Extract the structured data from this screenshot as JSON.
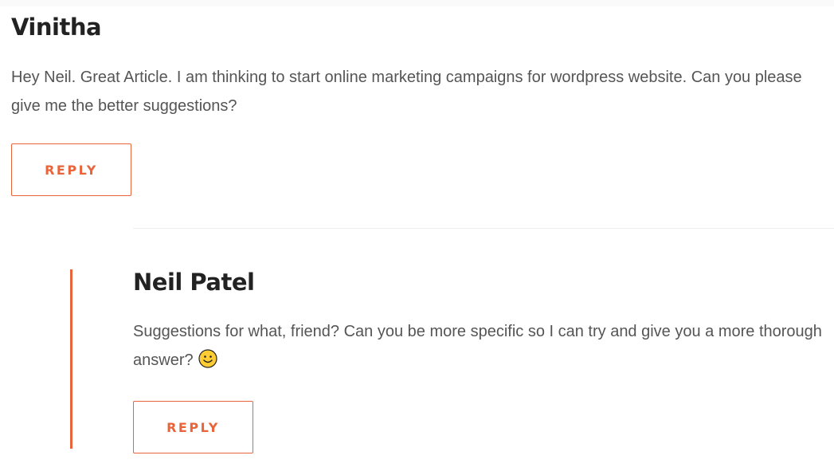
{
  "comments": [
    {
      "author": "Vinitha",
      "text": "Hey Neil. Great Article. I am thinking to start online marketing campaigns for wordpress website. Can you please give me the better suggestions?",
      "reply_label": "REPLY"
    },
    {
      "author": "Neil Patel",
      "text": "Suggestions for what, friend? Can you be more specific so I can try and give you a more thorough answer?",
      "emoji_icon": "smiley-face-icon",
      "reply_label": "REPLY"
    }
  ],
  "colors": {
    "accent": "#e8643a",
    "author_text": "#222222",
    "body_text": "#555555",
    "divider": "#eeeeee"
  }
}
